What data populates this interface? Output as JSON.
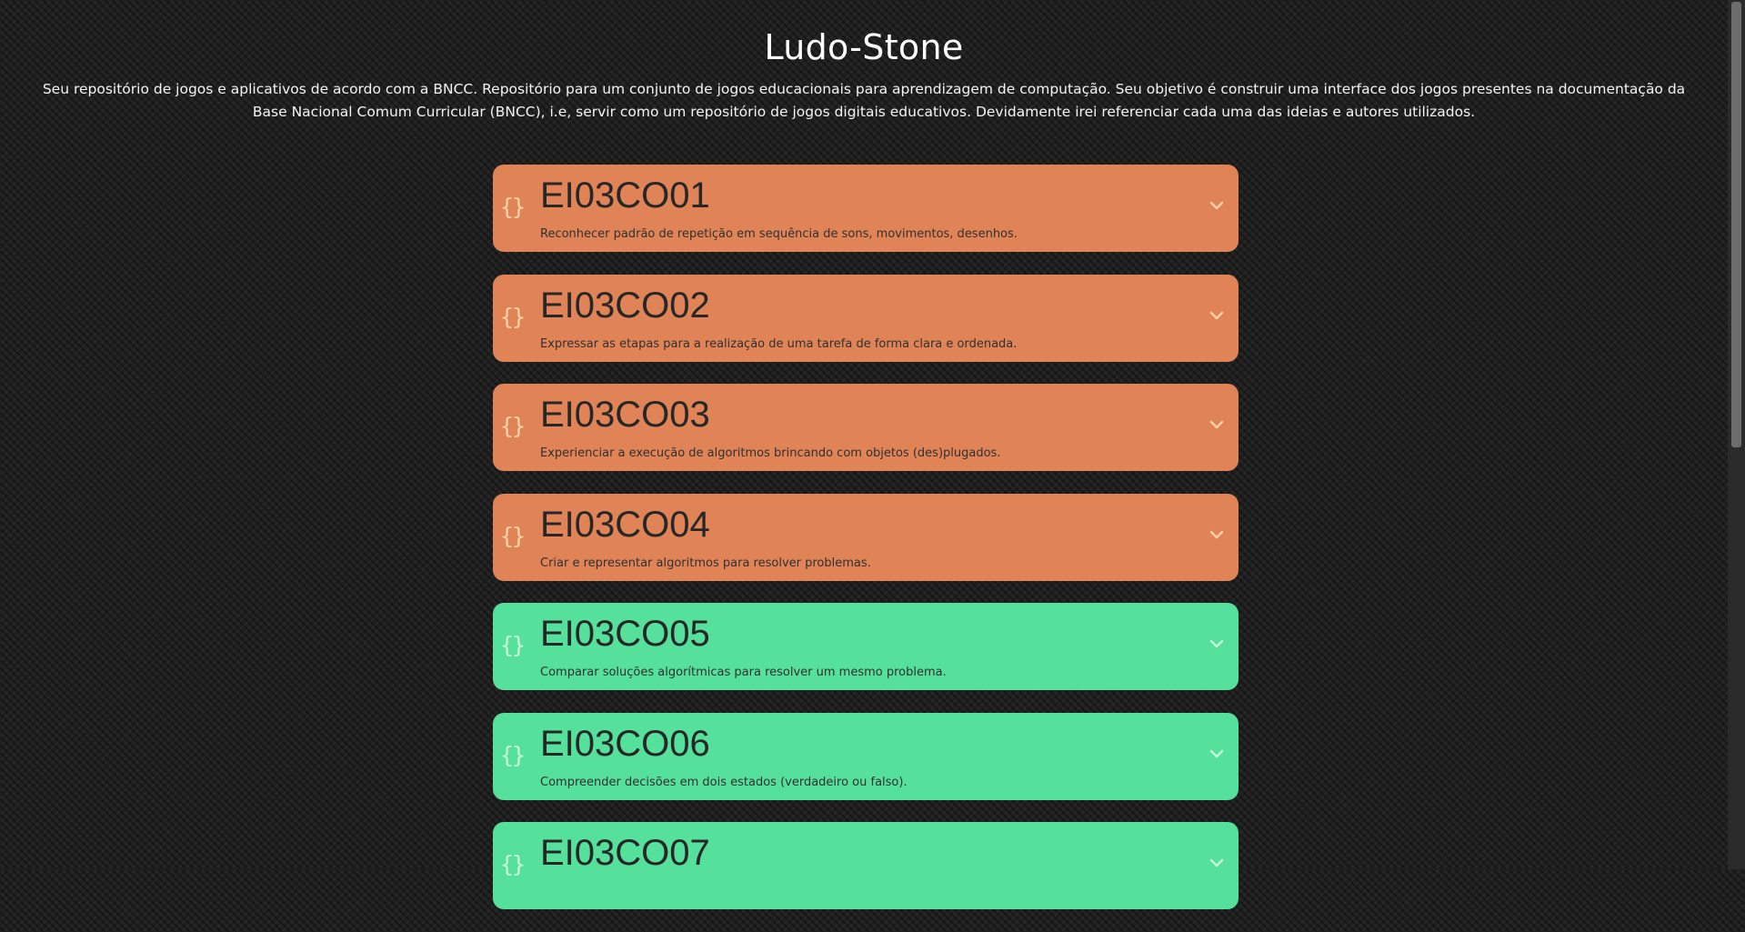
{
  "header": {
    "title": "Ludo-Stone",
    "description": "Seu repositório de jogos e aplicativos de acordo com a BNCC. Repositório para um conjunto de jogos educacionais para aprendizagem de computação. Seu objetivo é construir uma interface dos jogos presentes na documentação da Base Nacional Comum Curricular (BNCC), i.e, servir como um repositório de jogos digitais educativos. Devidamente irei referenciar cada uma das ideias e autores utilizados."
  },
  "cards": [
    {
      "code": "EI03CO01",
      "text": "Reconhecer padrão de repetição em sequência de sons, movimentos, desenhos.",
      "icon": "{}",
      "color": "#e08458"
    },
    {
      "code": "EI03CO02",
      "text": "Expressar as etapas para a realização de uma tarefa de forma clara e ordenada.",
      "icon": "{}",
      "color": "#e08458"
    },
    {
      "code": "EI03CO03",
      "text": "Experienciar a execução de algoritmos brincando com objetos (des)plugados.",
      "icon": "{}",
      "color": "#e08458"
    },
    {
      "code": "EI03CO04",
      "text": "Criar e representar algoritmos para resolver problemas.",
      "icon": "{}",
      "color": "#e08458"
    },
    {
      "code": "EI03CO05",
      "text": "Comparar soluções algorítmicas para resolver um mesmo problema.",
      "icon": "{}",
      "color": "#55e09b"
    },
    {
      "code": "EI03CO06",
      "text": "Compreender decisões em dois estados (verdadeiro ou falso).",
      "icon": "{}",
      "color": "#55e09b"
    },
    {
      "code": "EI03CO07",
      "text": "",
      "icon": "{}",
      "color": "#55e09b"
    }
  ],
  "colors": {
    "background": "#202020",
    "orange_card": "#e08458",
    "green_card": "#55e09b"
  }
}
